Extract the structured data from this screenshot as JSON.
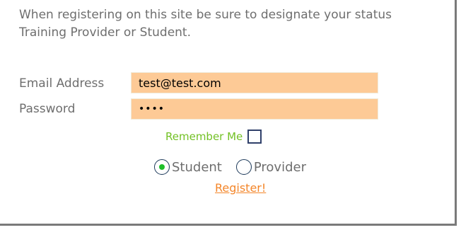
{
  "intro": {
    "line1": "When registering on this site be sure to designate your status",
    "line2": "Training Provider or Student."
  },
  "form": {
    "email_label": "Email Address",
    "email_value": "test@test.com",
    "password_label": "Password",
    "password_value": "••••",
    "remember_label": "Remember Me",
    "remember_checked": false,
    "status_options": [
      {
        "label": "Student",
        "selected": true
      },
      {
        "label": "Provider",
        "selected": false
      }
    ],
    "register_link": "Register!"
  },
  "colors": {
    "input_bg": "#fdca96",
    "remember_text": "#73c125",
    "register_link": "#f4862a",
    "label_text": "#6e6e6e"
  }
}
